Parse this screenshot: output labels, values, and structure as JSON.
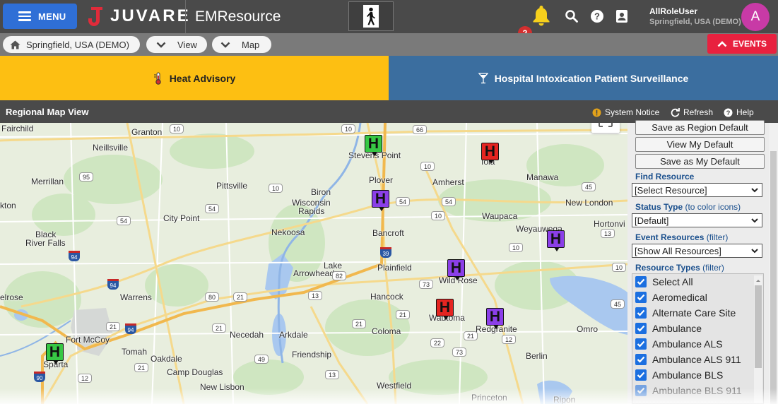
{
  "topbar": {
    "menu_label": "MENU",
    "logo_text": "JUVARE",
    "app_title": "EMResource",
    "notification_count": "2",
    "user_name": "AllRoleUser",
    "user_location": "Springfield, USA (DEMO)",
    "avatar_initial": "A",
    "icons": [
      "hamburger-icon",
      "juvare-logo-icon",
      "pedestrian-icon",
      "bell-icon",
      "search-icon",
      "help-icon",
      "contact-card-icon"
    ]
  },
  "subbar": {
    "region_label": "Springfield, USA (DEMO)",
    "view_label": "View",
    "map_label": "Map",
    "events_label": "EVENTS"
  },
  "banners": {
    "left": "Heat Advisory",
    "right": "Hospital Intoxication Patient Surveillance"
  },
  "section": {
    "title": "Regional Map View",
    "system_notice": "System Notice",
    "refresh": "Refresh",
    "help": "Help"
  },
  "map": {
    "places": [
      "Fairchild",
      "Granton",
      "Neillsville",
      "Merrillan",
      "kton",
      "Black",
      "River Falls",
      "Pittsville",
      "City Point",
      "Biron",
      "Wisconsin",
      "Rapids",
      "Nekoosa",
      "Stevens Point",
      "Plover",
      "Bancroft",
      "Amherst",
      "Iola",
      "Manawa",
      "New London",
      "Hortonvi",
      "Waupaca",
      "Weyauwega",
      "Lake",
      "Arrowhead",
      "Plainfield",
      "Wild Rose",
      "Hancock",
      "Wautoma",
      "Redgranite",
      "Omro",
      "elrose",
      "Warrens",
      "Fort McCoy",
      "Tomah",
      "Oakdale",
      "Sparta",
      "Camp Douglas",
      "Necedah",
      "Arkdale",
      "Friendship",
      "Coloma",
      "Berlin",
      "New Lisbon",
      "Westfield",
      "Princeton",
      "Ripon"
    ],
    "highways": [
      "10",
      "10",
      "66",
      "10",
      "95",
      "54",
      "54",
      "54",
      "54",
      "10",
      "45",
      "10",
      "45",
      "13",
      "73",
      "21",
      "21",
      "22",
      "73",
      "80",
      "21",
      "49",
      "13",
      "12",
      "21",
      "21",
      "13",
      "12",
      "10",
      "21",
      "21",
      "82",
      "10"
    ],
    "interstates": [
      "94",
      "94",
      "94",
      "39",
      "90"
    ]
  },
  "panel": {
    "save_region_default": "Save as Region Default",
    "view_my_default": "View My Default",
    "save_my_default": "Save as My Default",
    "find_resource_label": "Find Resource",
    "find_resource_value": "[Select Resource]",
    "status_type_label": "Status Type",
    "status_type_hint": "(to color icons)",
    "status_type_value": "[Default]",
    "event_resources_label": "Event Resources",
    "event_resources_hint": "(filter)",
    "event_resources_value": "[Show All Resources]",
    "resource_types_label": "Resource Types",
    "resource_types_hint": "(filter)",
    "resource_types": [
      {
        "label": "Select All",
        "checked": true
      },
      {
        "label": "Aeromedical",
        "checked": true
      },
      {
        "label": "Alternate Care Site",
        "checked": true
      },
      {
        "label": "Ambulance",
        "checked": true
      },
      {
        "label": "Ambulance ALS",
        "checked": true
      },
      {
        "label": "Ambulance ALS 911",
        "checked": true
      },
      {
        "label": "Ambulance BLS",
        "checked": true
      },
      {
        "label": "Ambulance BLS 911",
        "checked": true
      }
    ]
  },
  "markers": [
    {
      "color": "green",
      "label": "H"
    },
    {
      "color": "red",
      "label": "H"
    },
    {
      "color": "purple",
      "label": "H"
    },
    {
      "color": "purple",
      "label": "H"
    },
    {
      "color": "purple",
      "label": "H"
    },
    {
      "color": "red",
      "label": "H"
    },
    {
      "color": "purple",
      "label": "H"
    },
    {
      "color": "green",
      "label": "H"
    }
  ],
  "colors": {
    "topbar": "#4a4a4a",
    "menu_button": "#2f6fd6",
    "heat_banner": "#fdbf12",
    "surveillance_banner": "#3b6e9f",
    "events_button": "#e8213f",
    "avatar": "#c83aa6",
    "marker_green": "#37c844",
    "marker_red": "#e52521",
    "marker_purple": "#8b3fe8",
    "checkbox": "#1b6fe0",
    "panel_label": "#1a4f8d"
  }
}
